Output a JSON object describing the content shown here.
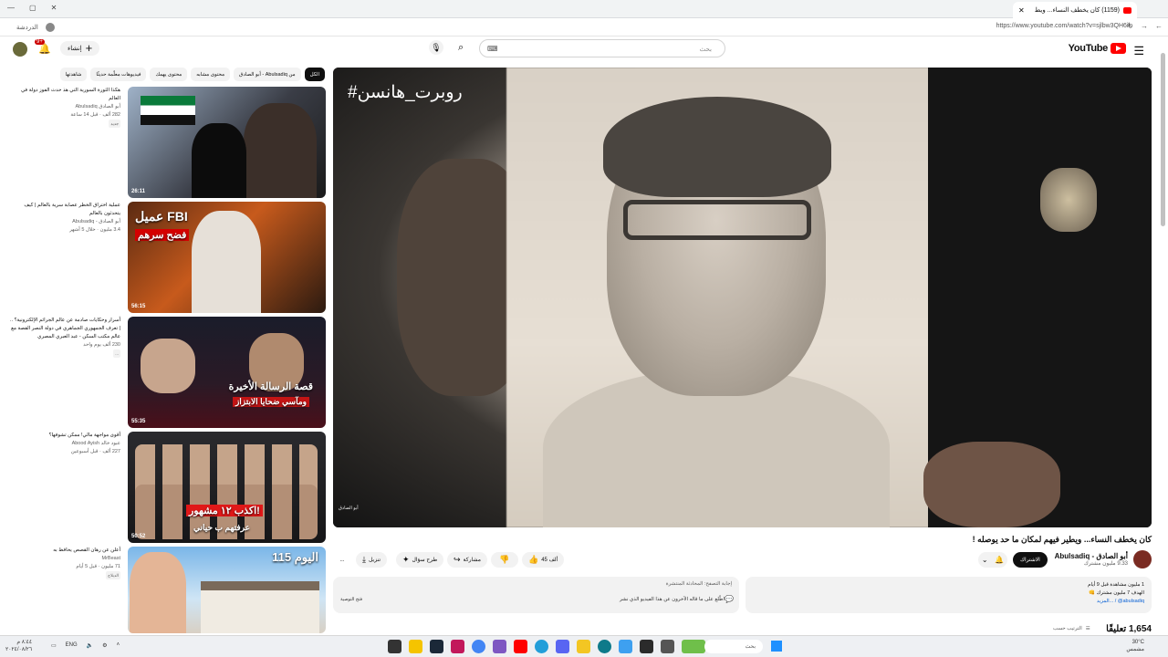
{
  "browser": {
    "tab_title": "(1159) كان يخطف النساء... ويط",
    "url": "https://www.youtube.com/watch?v=sjlbw3QH6ik",
    "profile_label": "الدردشة",
    "window_controls": [
      "—",
      "▢",
      "✕"
    ]
  },
  "masthead": {
    "logo_text": "YouTube",
    "search_placeholder": "بحث",
    "create_label": "إنشاء",
    "notification_count": "9+"
  },
  "player": {
    "overlay_title": "#روبرت_هانسن",
    "watermark": "أبو الصادق"
  },
  "video": {
    "title": "كان يخطف النساء... ويطير فيهم لمكان ما حد يوصله !",
    "channel_name": "أبو الصادق - Abulsadiq",
    "subscribers": "9.33 مليون مشترك",
    "subscribe_label": "الاشتراك",
    "like_count": "45 ألف",
    "share_label": "مشاركة",
    "ask_label": "طرح سؤال",
    "download_label": "تنزيل",
    "more_label": "..."
  },
  "description": {
    "line1": "1 مليون مشاهدة قبل 9 أيام",
    "line2": "الهدف 7 مليون مشترك 👊",
    "line3": "abulsadiq@ / ...المزيد"
  },
  "summary": {
    "header": "إجابة التصفح: المحادثة المنتشرة",
    "text": "اطّلع على ما قاله الآخرون عن هذا الفيديو الذي نشر",
    "ask": "فتح التوصية"
  },
  "comments": {
    "count": "1,654 تعليقًا",
    "sort_label": "الترتيب حسب"
  },
  "chips": [
    "الكل",
    "من Abulsadiq - أبو الصادق",
    "محتوى مشابه",
    "محتوى يهمك",
    "فيديوهات معلّمة حديثًا",
    "شاهدتها"
  ],
  "related": [
    {
      "title": "هكذا الثورة السورية التي هذ حدث الفوز دولة في العالم",
      "channel": "أبو الصادق Abulsadiq",
      "meta": "282 ألف · قبل 14 ساعة",
      "badge": "جديد",
      "duration": "26:11"
    },
    {
      "title": "عملية اختراق الخطر عصابة سرية بالعالم | كيف يتحدثون بالعالم",
      "channel": "أبو الصادق - Abulsadiq",
      "meta": "3.4 مليون · خلال 5 أشهر",
      "badge": "",
      "duration": "56:15",
      "thumb_text1": "عميل FBI",
      "thumb_text2": "فضح سرهم"
    },
    {
      "title": "أسرار وحكايات صادمة عن عالم الجرائم الإلكترونية؟ .. | تعرف الجمهوري الجماهري في دولة النصر القصة مع عالم مكتب السكن - عبد العبري المصري",
      "channel": "",
      "meta": "230 ألف يوم واحد",
      "badge": "...",
      "duration": "55:35",
      "thumb_text1": "قصة الرسالة الأخيرة",
      "thumb_text2": "ومآسي ضحايا الابتزاز"
    },
    {
      "title": "أقوى مواجهة مالي! ممكن تشوفها؟",
      "channel": "عبود خالد Abood Ayish",
      "meta": "227 ألف · قبل أسبوعين",
      "badge": "",
      "duration": "50:52",
      "thumb_text1": "اكذب ١٢ مشهور!",
      "thumb_text2": "عرفتهم ب حياني"
    },
    {
      "title": "أعلن عن رهان القصص يحافظ به",
      "channel": "MrBeast",
      "meta": "71 مليون · قبل 5 أيام",
      "badge": "الدبلاج",
      "duration": "",
      "thumb_text1": "اليوم 115"
    }
  ],
  "taskbar": {
    "search_placeholder": "بحث",
    "time": "٨:٤٤ م",
    "date": "٢٠٢٤/٠٨/٢٦",
    "lang": "ENG",
    "weather_temp": "30°C",
    "weather_desc": "مشمس"
  }
}
